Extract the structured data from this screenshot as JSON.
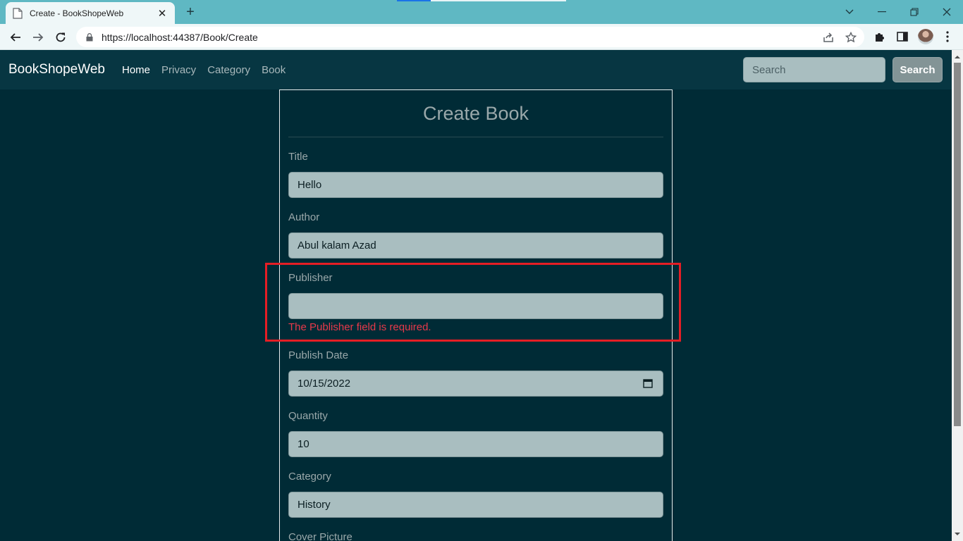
{
  "browser": {
    "tab_title": "Create - BookShopeWeb",
    "tab_close": "✕",
    "new_tab": "+",
    "url": "https://localhost:44387/Book/Create"
  },
  "navbar": {
    "brand": "BookShopeWeb",
    "links": [
      "Home",
      "Privacy",
      "Category",
      "Book"
    ],
    "active_link": "Home",
    "search_placeholder": "Search",
    "search_button": "Search"
  },
  "form": {
    "heading": "Create Book",
    "title_label": "Title",
    "title_value": "Hello",
    "author_label": "Author",
    "author_value": "Abul kalam Azad",
    "publisher_label": "Publisher",
    "publisher_value": "",
    "publisher_error": "The Publisher field is required.",
    "publish_date_label": "Publish Date",
    "publish_date_value": "10/15/2022",
    "quantity_label": "Quantity",
    "quantity_value": "10",
    "category_label": "Category",
    "category_value": "History",
    "cover_label": "Cover Picture"
  },
  "colors": {
    "page_bg": "#002b36",
    "navbar_bg": "#073642",
    "input_bg": "#a9bec0",
    "error": "#e8394a",
    "highlight": "#e51e25",
    "tabstrip": "#5fb8c3"
  }
}
